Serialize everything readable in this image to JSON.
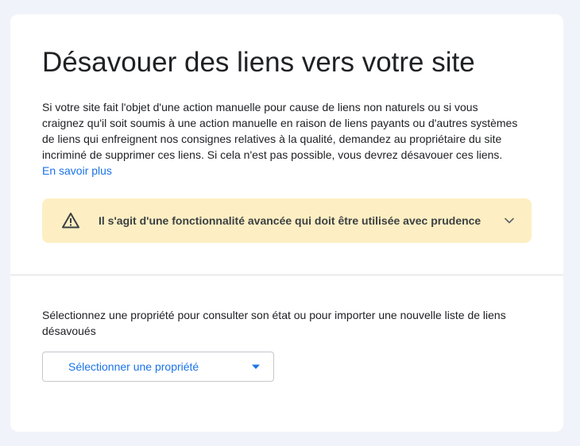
{
  "page": {
    "title": "Désavouer des liens vers votre site",
    "intro_text": "Si votre site fait l'objet d'une action manuelle pour cause de liens non naturels ou si vous craignez qu'il soit soumis à une action manuelle en raison de liens payants ou d'autres systèmes de liens qui enfreignent nos consignes relatives à la qualité, demandez au propriétaire du site incriminé de supprimer ces liens. Si cela n'est pas possible, vous devrez désavouer ces liens.",
    "learn_more_link": "En savoir plus"
  },
  "warning": {
    "text": "Il s'agit d'une fonctionnalité avancée qui doit être utilisée avec prudence",
    "icon": "warning-triangle-icon",
    "expand_icon": "chevron-down-icon",
    "background_color": "#fdefc3"
  },
  "property_section": {
    "prompt": "Sélectionnez une propriété pour consulter son état ou pour importer une nouvelle liste de liens désavoués",
    "select_label": "Sélectionner une propriété",
    "select_icon": "dropdown-arrow-icon"
  },
  "colors": {
    "accent": "#1a73e8",
    "page_background": "#f0f3f9",
    "card_background": "#ffffff"
  }
}
